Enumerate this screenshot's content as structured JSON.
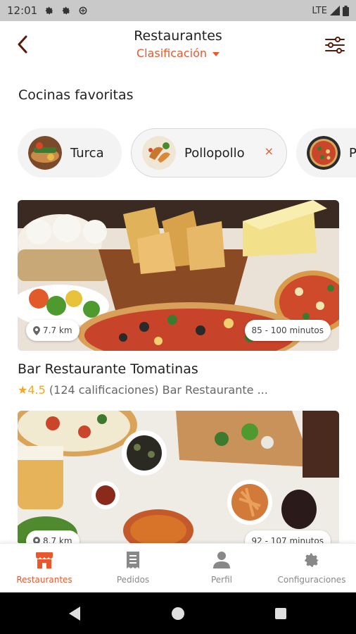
{
  "status_bar": {
    "time": "12:01",
    "network": "LTE"
  },
  "header": {
    "title": "Restaurantes",
    "subtitle": "Clasificación"
  },
  "section": {
    "title": "Cocinas favoritas"
  },
  "chips": [
    {
      "label": "Turca",
      "selected": false
    },
    {
      "label": "Pollopollo",
      "selected": true,
      "remove_label": "×"
    },
    {
      "label": "P",
      "selected": false
    }
  ],
  "restaurants": [
    {
      "name": "Bar Restaurante Tomatinas",
      "distance": "7.7 km",
      "delivery_time": "85 - 100 minutos",
      "star": "★",
      "rating": "4.5",
      "meta": "(124 calificaciones) Bar Restaurante ..."
    },
    {
      "name": "",
      "distance": "8.7 km",
      "delivery_time": "92 - 107 minutos"
    }
  ],
  "bottom_nav": [
    {
      "label": "Restaurantes",
      "icon": "storefront-icon",
      "active": true
    },
    {
      "label": "Pedidos",
      "icon": "receipt-icon",
      "active": false
    },
    {
      "label": "Perfil",
      "icon": "person-icon",
      "active": false
    },
    {
      "label": "Configuraciones",
      "icon": "gear-icon",
      "active": false
    }
  ],
  "colors": {
    "accent": "#e8582c",
    "rating": "#f5a623",
    "status_bar": "#c9c9c9",
    "system_nav": "#000000"
  }
}
